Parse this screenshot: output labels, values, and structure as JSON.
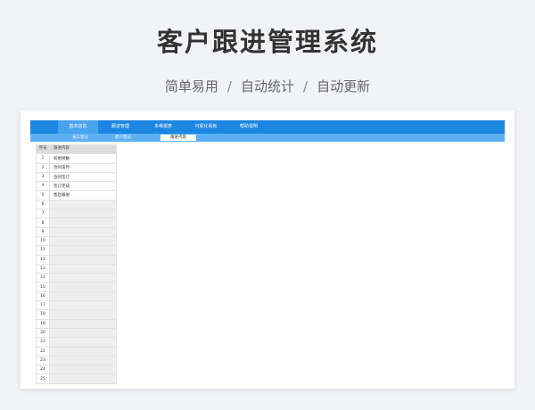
{
  "header": {
    "title": "客户跟进管理系统",
    "features": [
      "简单易用",
      "自动统计",
      "自动更新"
    ],
    "separator": "/"
  },
  "tabs": [
    {
      "label": "基本信息",
      "active": true
    },
    {
      "label": "跟进管理",
      "active": false
    },
    {
      "label": "多维报表",
      "active": false
    },
    {
      "label": "可视化看板",
      "active": false
    },
    {
      "label": "帮助说明",
      "active": false
    }
  ],
  "subtabs": [
    {
      "label": "员工登记",
      "active": false
    },
    {
      "label": "客户登记",
      "active": false
    },
    {
      "label": "跟进内容",
      "active": true
    }
  ],
  "table": {
    "col_num_header": "序号",
    "col_content_header": "跟进内容",
    "rows": [
      {
        "num": "1",
        "content": "初始接触"
      },
      {
        "num": "2",
        "content": "合同谈判"
      },
      {
        "num": "3",
        "content": "合同签订"
      },
      {
        "num": "4",
        "content": "签订完成"
      },
      {
        "num": "5",
        "content": "售后跟进"
      },
      {
        "num": "6",
        "content": ""
      },
      {
        "num": "7",
        "content": ""
      },
      {
        "num": "8",
        "content": ""
      },
      {
        "num": "9",
        "content": ""
      },
      {
        "num": "10",
        "content": ""
      },
      {
        "num": "11",
        "content": ""
      },
      {
        "num": "12",
        "content": ""
      },
      {
        "num": "13",
        "content": ""
      },
      {
        "num": "14",
        "content": ""
      },
      {
        "num": "15",
        "content": ""
      },
      {
        "num": "16",
        "content": ""
      },
      {
        "num": "17",
        "content": ""
      },
      {
        "num": "18",
        "content": ""
      },
      {
        "num": "19",
        "content": ""
      },
      {
        "num": "20",
        "content": ""
      },
      {
        "num": "21",
        "content": ""
      },
      {
        "num": "22",
        "content": ""
      },
      {
        "num": "23",
        "content": ""
      },
      {
        "num": "24",
        "content": ""
      },
      {
        "num": "25",
        "content": ""
      }
    ]
  }
}
